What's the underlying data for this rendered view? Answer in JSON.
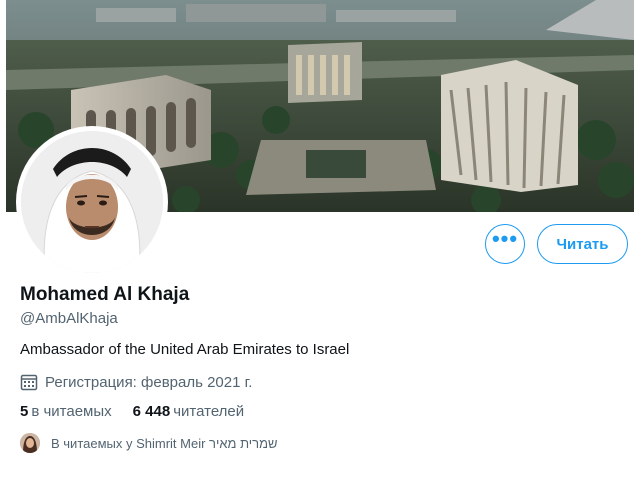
{
  "profile": {
    "name": "Mohamed Al Khaja",
    "handle": "@AmbAlKhaja",
    "bio": "Ambassador of the United Arab Emirates to Israel",
    "joined": "Регистрация: февраль 2021 г."
  },
  "actions": {
    "more_label": "•••",
    "follow_label": "Читать"
  },
  "stats": {
    "following_count": "5",
    "following_label": "в читаемых",
    "followers_count": "6 448",
    "followers_label": "читателей"
  },
  "followed_by": {
    "text": "В читаемых у Shimrit Meir שמרית מאיר"
  },
  "icons": {
    "calendar": "calendar-icon",
    "more": "more-icon"
  },
  "colors": {
    "accent": "#1d9bf0",
    "text_primary": "#0f1419",
    "text_secondary": "#536471"
  }
}
